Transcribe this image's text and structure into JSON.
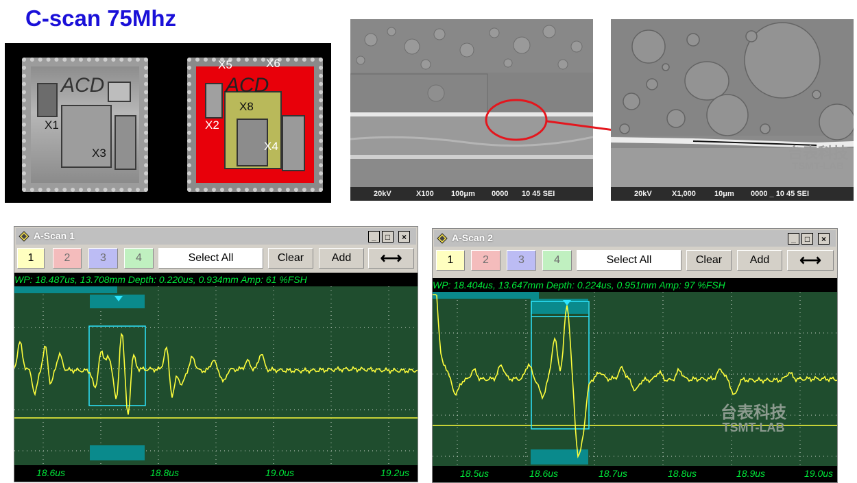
{
  "page_title": "C-scan 75Mhz",
  "cscan": {
    "markers": [
      "X1",
      "X2",
      "X3",
      "X4",
      "X5",
      "X6",
      "X8"
    ],
    "chip_mark": "ACD",
    "defect_color": "#ff0000"
  },
  "sem_100": {
    "kv": "20kV",
    "mag": "X100",
    "scale": "100μm",
    "id": "0000",
    "wd": "10 45 SEI"
  },
  "sem_1000": {
    "kv": "20kV",
    "mag": "X1,000",
    "scale": "10μm",
    "id": "0000 _ 10 45 SEI",
    "watermark_cn": "台表科技",
    "watermark_en": "TSMT-LAB"
  },
  "ascan1": {
    "title": "A-Scan 1",
    "buttons": [
      "1",
      "2",
      "3",
      "4"
    ],
    "select_all": "Select All",
    "clear": "Clear",
    "add": "Add",
    "arrow": "⟷",
    "status": "WP: 18.487us, 13.708mm  Depth: 0.220us, 0.934mm  Amp:   61 %FSH",
    "ticks": [
      "18.6us",
      "18.8us",
      "19.0us",
      "19.2us"
    ]
  },
  "ascan2": {
    "title": "A-Scan 2",
    "buttons": [
      "1",
      "2",
      "3",
      "4"
    ],
    "select_all": "Select All",
    "clear": "Clear",
    "add": "Add",
    "arrow": "⟷",
    "status": "WP: 18.404us, 13.647mm  Depth: 0.224us, 0.951mm  Amp:   97 %FSH",
    "ticks": [
      "18.5us",
      "18.6us",
      "18.7us",
      "18.8us",
      "18.9us",
      "19.0us"
    ],
    "watermark_cn": "台表科技",
    "watermark_en": "TSMT-LAB"
  },
  "colors": {
    "title": "#1a10d8",
    "plot_bg": "#1f4d2e",
    "trace": "#ffff3c",
    "gate": "#00c8d0",
    "status_text": "#00e83a",
    "arrow": "#e4161d"
  },
  "icons": [
    "diamond-app-icon",
    "minimize-icon",
    "maximize-icon",
    "close-icon",
    "double-arrow-icon"
  ]
}
